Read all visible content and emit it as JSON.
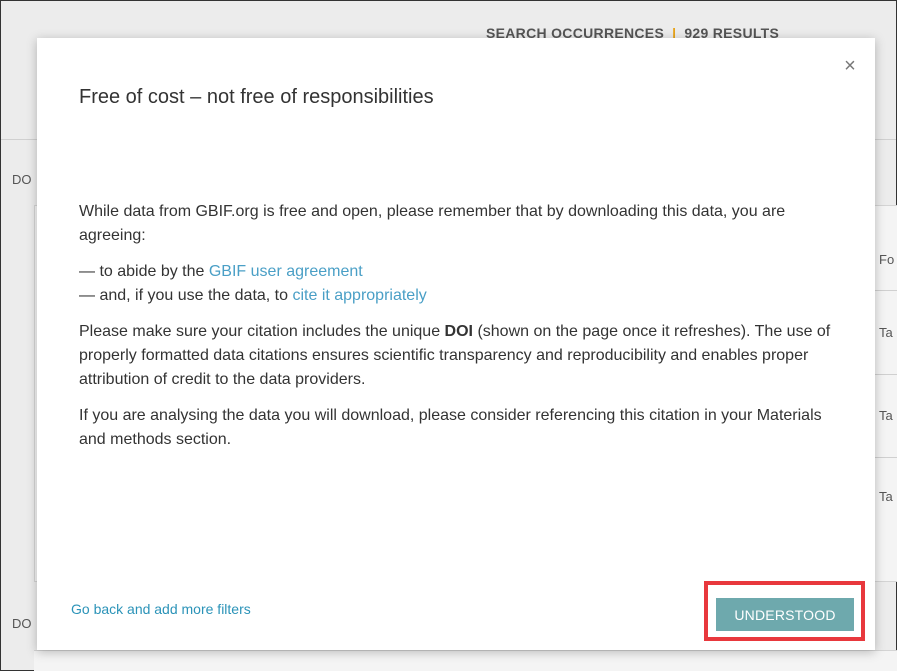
{
  "background": {
    "header_title_left": "SEARCH OCCURRENCES",
    "header_title_right": "929 RESULTS",
    "left_labels": [
      "DO",
      "DO"
    ],
    "right_labels": [
      "Fo",
      "Ta",
      "Ta",
      "Ta"
    ]
  },
  "modal": {
    "title": "Free of cost – not free of responsibilities",
    "intro": "While data from GBIF.org is free and open, please remember that by downloading this data, you are agreeing:",
    "item1_prefix": "— to abide by the ",
    "item1_link": "GBIF user agreement",
    "item2_prefix": "— and, if you use the data, to ",
    "item2_link": "cite it appropriately",
    "citation_pre": "Please make sure your citation includes the unique ",
    "citation_bold": "DOI",
    "citation_post": " (shown on the page once it refreshes). The use of properly formatted data citations ensures scientific transparency and reproducibility and enables proper attribution of credit to the data providers.",
    "analysis": "If you are analysing the data you will download, please consider referencing this citation in your Materials and methods section.",
    "back_link": "Go back and add more filters",
    "confirm_label": "UNDERSTOOD",
    "close_glyph": "×"
  }
}
